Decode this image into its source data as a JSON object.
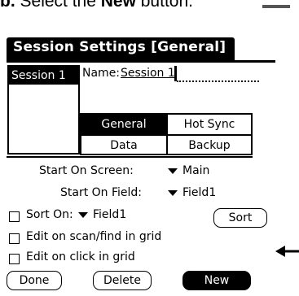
{
  "instruction": {
    "step_prefix": "b.",
    "text_before": " Select the ",
    "emphasis": "New",
    "text_after": " button."
  },
  "form": {
    "title": "Session Settings [General]"
  },
  "session_list": {
    "items": [
      {
        "label": "Session 1",
        "selected": true
      }
    ]
  },
  "name_field": {
    "label": "Name:",
    "value": "Session 1"
  },
  "tabs": [
    {
      "label": "General",
      "selected": true
    },
    {
      "label": "Hot Sync",
      "selected": false
    },
    {
      "label": "Data",
      "selected": false
    },
    {
      "label": "Backup",
      "selected": false
    }
  ],
  "settings": {
    "start_on_screen": {
      "label": "Start On Screen:",
      "value": "Main"
    },
    "start_on_field": {
      "label": "Start On Field:",
      "value": "Field1"
    },
    "sort_on": {
      "label": "Sort On:",
      "value": "Field1",
      "checked": false,
      "button": "Sort"
    },
    "edit_on_scan": {
      "label": "Edit on scan/find in grid",
      "checked": false
    },
    "edit_on_click": {
      "label": "Edit on click in grid",
      "checked": false
    }
  },
  "buttons": {
    "done": "Done",
    "delete": "Delete",
    "new": "New"
  },
  "icons": {
    "pointer": "arrow-left-icon",
    "dropdown": "triangle-down-icon"
  },
  "colors": {
    "foreground": "#000000",
    "background": "#ffffff"
  }
}
